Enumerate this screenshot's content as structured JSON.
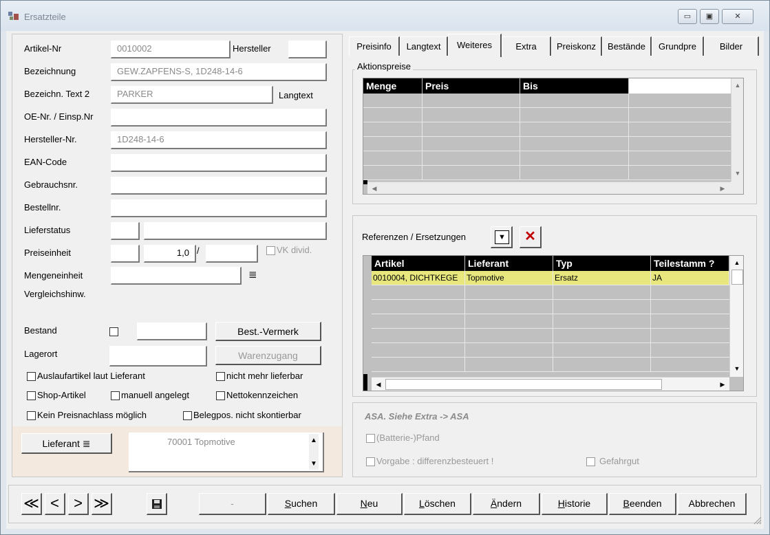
{
  "window": {
    "title": "Ersatzteile",
    "controls": {
      "minimize": "▭",
      "maximize": "▣",
      "close": "✕"
    }
  },
  "form": {
    "artikel_nr": {
      "label": "Artikel-Nr",
      "value": "0010002"
    },
    "hersteller": {
      "label": "Hersteller",
      "value": ""
    },
    "bezeichnung": {
      "label": "Bezeichnung",
      "value": "GEW.ZAPFENS-S, 1D248-14-6"
    },
    "bezeichnung2": {
      "label": "Bezeichn. Text 2",
      "value": "PARKER"
    },
    "langtext_label": "Langtext",
    "oe_nr": {
      "label": "OE-Nr. / Einsp.Nr",
      "value": ""
    },
    "hersteller_nr": {
      "label": "Hersteller-Nr.",
      "value": "1D248-14-6"
    },
    "ean": {
      "label": "EAN-Code",
      "value": ""
    },
    "gebrauchsnr": {
      "label": "Gebrauchsnr.",
      "value": ""
    },
    "bestellnr": {
      "label": "Bestellnr.",
      "value": ""
    },
    "lieferstatus": {
      "label": "Lieferstatus",
      "value": ""
    },
    "preiseinheit": {
      "label": "Preiseinheit",
      "value": "1,0",
      "sep": "/"
    },
    "vk_divid": "VK divid.",
    "mengeneinheit": {
      "label": "Mengeneinheit",
      "icon": "≣"
    },
    "vergleichshinw": {
      "label": "Vergleichshinw."
    },
    "bestand": {
      "label": "Bestand",
      "value": ""
    },
    "best_vermerk": "Best.-Vermerk",
    "lagerort": {
      "label": "Lagerort",
      "value": ""
    },
    "warenzugang": "Warenzugang",
    "checks": {
      "auslauf": "Auslaufartikel laut Lieferant",
      "nicht_mehr": "nicht mehr lieferbar",
      "shop": "Shop-Artikel",
      "manuell": "manuell angelegt",
      "netto": "Nettokennzeichen",
      "kein_nachlass": "Kein Preisnachlass möglich",
      "belegpos": "Belegpos. nicht skontierbar"
    },
    "lieferant_button": "Lieferant ≣",
    "lieferant_value": "70001 Topmotive"
  },
  "tabs": [
    "Preisinfo",
    "Langtext",
    "Weiteres",
    "Extra",
    "Preiskonz",
    "Bestände",
    "Grundpre",
    "Bilder"
  ],
  "selected_tab": "Weiteres",
  "aktionspreise": {
    "legend": "Aktionspreise",
    "columns": [
      "Menge",
      "Preis",
      "Bis"
    ]
  },
  "referenzen": {
    "label": "Referenzen / Ersetzungen",
    "columns": [
      "Artikel",
      "Lieferant",
      "Typ",
      "Teilestamm ?"
    ],
    "rows": [
      {
        "artikel": "0010004, DICHTKEGE",
        "lieferant": "Topmotive",
        "typ": "Ersatz",
        "teilestamm": "JA"
      }
    ]
  },
  "asa": {
    "title": "ASA. Siehe Extra -> ASA",
    "pfand": "(Batterie-)Pfand",
    "vorgabe": "Vorgabe : differenzbesteuert !",
    "gefahrgut": "Gefahrgut"
  },
  "bottom": {
    "nav": [
      "≪",
      "<",
      ">",
      "≫"
    ],
    "dash": "-",
    "suchen": {
      "u": "S",
      "rest": "uchen"
    },
    "neu": {
      "u": "N",
      "rest": "eu"
    },
    "loeschen": {
      "u": "L",
      "rest": "öschen"
    },
    "aendern": {
      "u": "Ä",
      "rest": "ndern"
    },
    "historie": {
      "u": "H",
      "rest": "istorie"
    },
    "beenden": {
      "u": "B",
      "rest": "eenden"
    },
    "abbrechen": "Abbrechen"
  },
  "colors": {
    "highlight_row": "#e7e77e",
    "grid_bg": "#c0c0c0",
    "lieferant_panel": "#f3e9df"
  }
}
